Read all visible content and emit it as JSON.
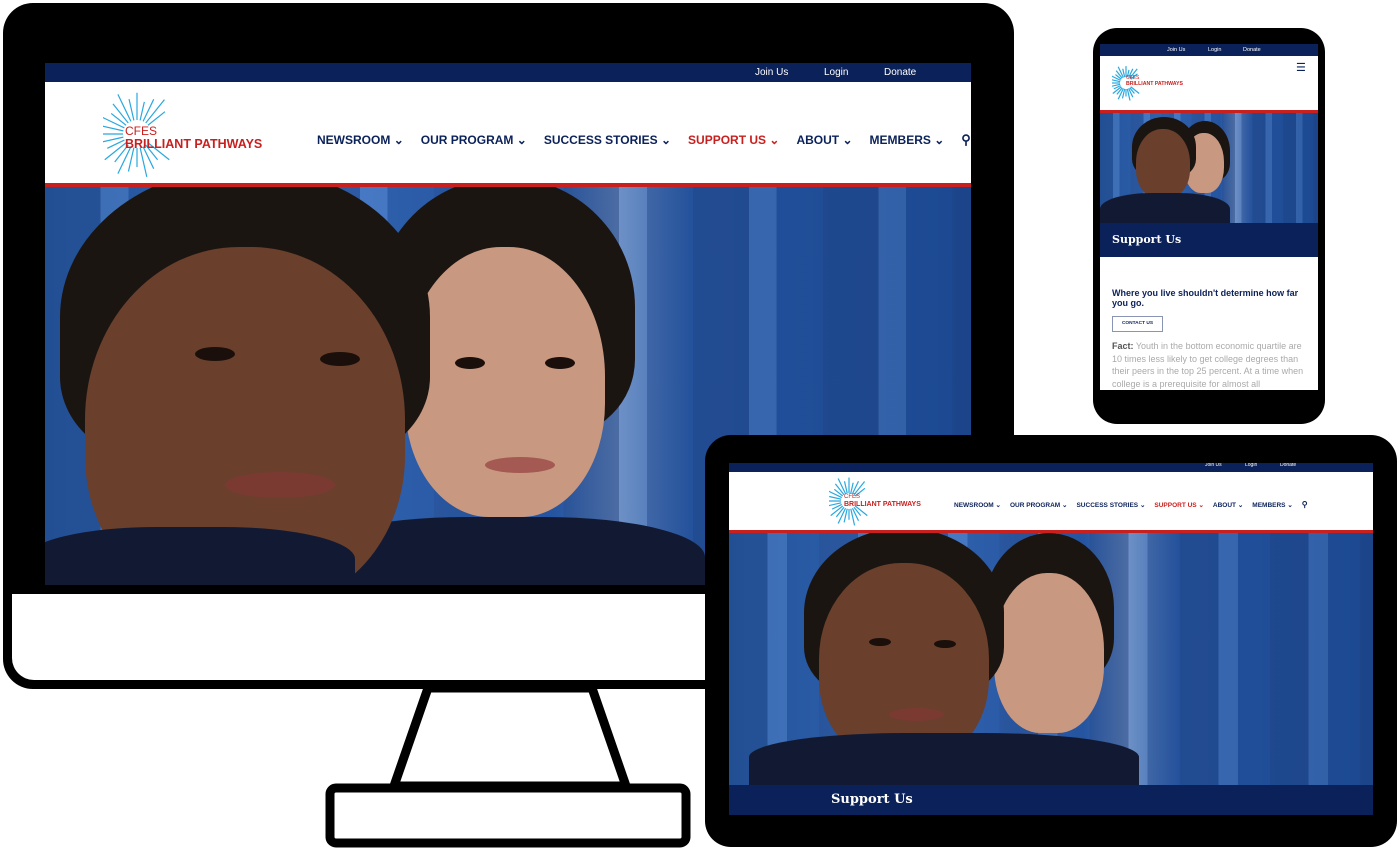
{
  "site": {
    "top_links": [
      "Join Us",
      "Login",
      "Donate"
    ],
    "logo_line1": "CFES",
    "logo_line2": "BRILLIANT PATHWAYS",
    "nav": [
      "NEWSROOM",
      "OUR PROGRAM",
      "SUCCESS STORIES",
      "SUPPORT US",
      "ABOUT",
      "MEMBERS"
    ],
    "active_nav": "SUPPORT US",
    "page_title": "Support Us",
    "headline": "Where you live shouldn't determine how far you go.",
    "contact_button": "CONTACT US",
    "fact_label": "Fact:",
    "fact_text": " Youth in the bottom economic quartile are 10 times less likely to get college degrees than their peers in the top 25 percent. At a time when college is a prerequisite for almost all"
  },
  "colors": {
    "navy": "#0b2159",
    "red": "#c8201e",
    "logo_blue": "#29a8e0"
  },
  "icons": {
    "search": "search-icon",
    "menu": "hamburger-menu-icon",
    "chevron": "chevron-down-icon"
  }
}
